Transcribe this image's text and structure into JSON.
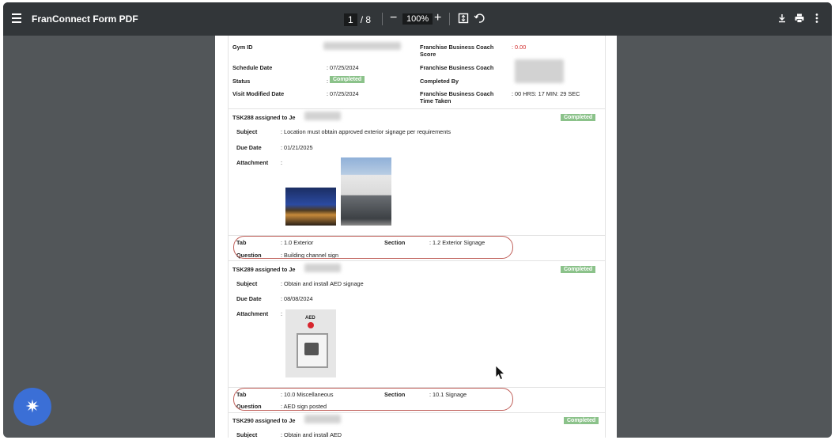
{
  "toolbar": {
    "title": "FranConnect Form PDF",
    "page_current": "1",
    "page_total": "/ 8",
    "zoom": "100%",
    "minus": "−",
    "plus": "+"
  },
  "header": {
    "gym_id_label": "Gym ID",
    "coach_score_label": "Franchise Business Coach",
    "coach_score_label2": "Score",
    "coach_score_value": ": 0.00",
    "schedule_date_label": "Schedule Date",
    "schedule_date_value": ": 07/25/2024",
    "coach_label": "Franchise Business Coach",
    "status_label": "Status",
    "status_colon": ":",
    "status_value": "Completed",
    "completed_by_label": "Completed By",
    "visit_modified_label": "Visit Modified Date",
    "visit_modified_value": ": 07/25/2024",
    "time_taken_label": "Franchise Business Coach",
    "time_taken_label2": "Time Taken",
    "time_taken_value": ": 00 HRS: 17 MIN: 29 SEC"
  },
  "tasks": [
    {
      "id_text": "TSK288  assigned to  Je",
      "status": "Completed",
      "subject_label": "Subject",
      "subject_value": ": Location must obtain approved exterior signage per requirements",
      "due_label": "Due Date",
      "due_value": ": 01/21/2025",
      "attachment_label": "Attachment",
      "attachment_colon": ":",
      "tab_label": "Tab",
      "tab_value": ": 1.0 Exterior",
      "section_label": "Section",
      "section_value": ": 1.2 Exterior Signage",
      "question_label": "Question",
      "question_value": ": Building channel sign"
    },
    {
      "id_text": "TSK289  assigned to  Je",
      "status": "Completed",
      "subject_label": "Subject",
      "subject_value": ": Obtain and install AED signage",
      "due_label": "Due Date",
      "due_value": ": 08/08/2024",
      "attachment_label": "Attachment",
      "attachment_colon": ":",
      "tab_label": "Tab",
      "tab_value": ": 10.0 Miscellaneous",
      "section_label": "Section",
      "section_value": ": 10.1 Signage",
      "question_label": "Question",
      "question_value": ": AED sign posted"
    },
    {
      "id_text": "TSK290  assigned to  Je",
      "status": "Completed",
      "subject_label": "Subject",
      "subject_value": ": Obtain and install AED"
    }
  ],
  "aed_label": "AED",
  "fab_glyph": "✷",
  "colors": {
    "toolbar": "#323639",
    "viewer_bg": "#525659",
    "badge": "#8bc28a",
    "highlight_oval": "#c0605a",
    "fab": "#3b6fd6"
  }
}
